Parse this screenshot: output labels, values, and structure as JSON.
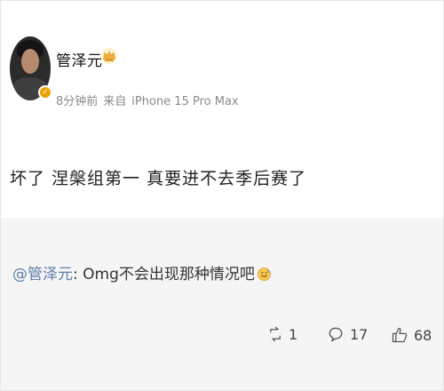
{
  "post": {
    "username": "管泽元",
    "time_ago": "8分钟前",
    "source_prefix": "来自",
    "source_device": "iPhone 15 Pro Max",
    "content": "坏了 涅槃组第一 真要进不去季后赛了",
    "icons": {
      "avatar": "user-avatar",
      "verified": "verified-badge-icon",
      "crown": "crown-icon"
    }
  },
  "forward": {
    "mention": "@管泽元",
    "separator": ":",
    "text": " Omg不会出现那种情况吧",
    "emoji": "sweat-smile-emoji"
  },
  "actions": {
    "repost_count": "1",
    "comment_count": "17",
    "like_count": "68",
    "icons": {
      "repost": "repost-icon",
      "comment": "comment-icon",
      "like": "thumbs-up-icon"
    }
  },
  "colors": {
    "mention": "#5b7ea9",
    "forward_background": "#f5f5f5",
    "crown": "#f0b040",
    "verified": "#f0a000"
  }
}
